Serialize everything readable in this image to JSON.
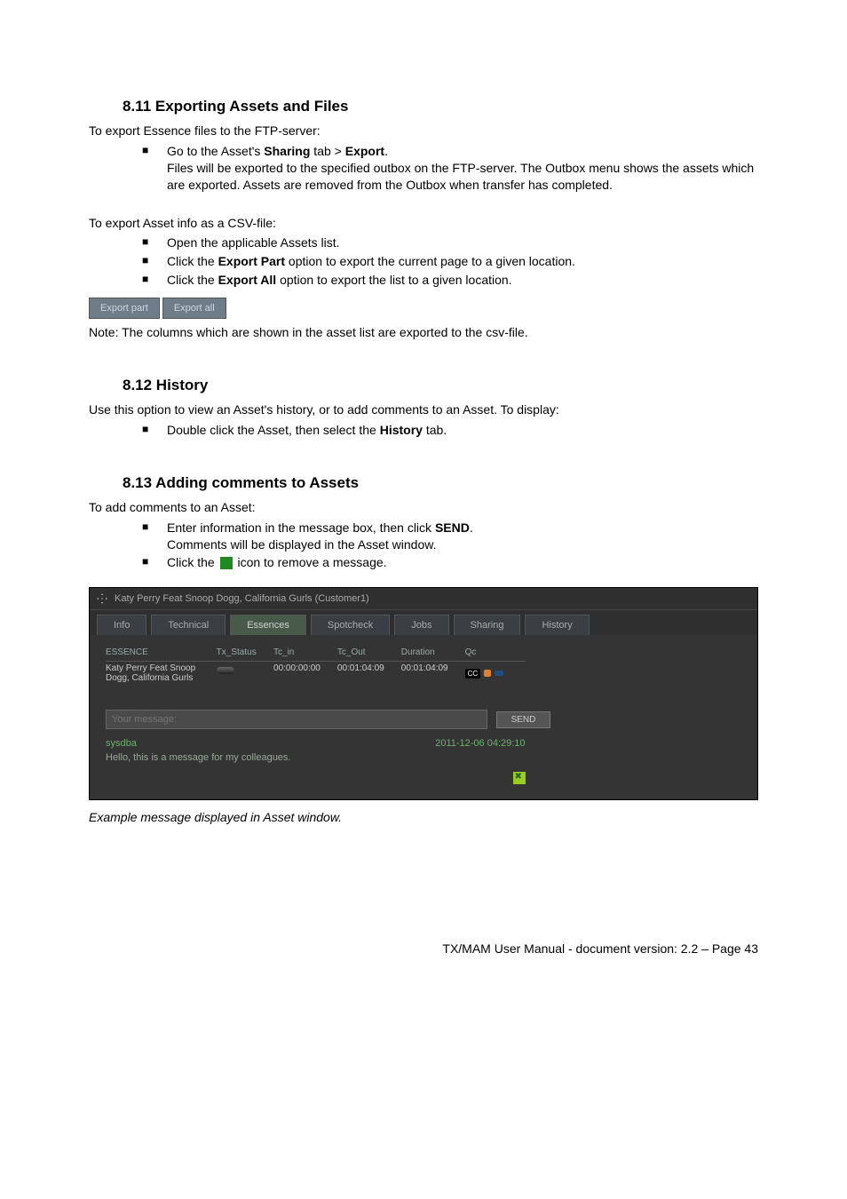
{
  "sections": {
    "s811": {
      "title": "8.11 Exporting Assets and Files"
    },
    "s812": {
      "title": "8.12 History"
    },
    "s813": {
      "title": "8.13 Adding comments to Assets"
    }
  },
  "text": {
    "export_ftp_intro": "To export Essence files to the FTP-server:",
    "export_ftp_b1a": "Go to the Asset's ",
    "export_ftp_b1_bold1": "Sharing",
    "export_ftp_b1b": " tab > ",
    "export_ftp_b1_bold2": "Export",
    "export_ftp_b1c": ".",
    "export_ftp_b1_sub": "Files will be exported to the specified outbox on the FTP-server. The Outbox menu shows the assets which are exported. Assets are removed from the Outbox when transfer has completed.",
    "export_csv_intro": "To export Asset info as a CSV-file:",
    "export_csv_b1": "Open the applicable Assets list.",
    "export_csv_b2a": "Click the ",
    "export_csv_b2_bold": "Export Part",
    "export_csv_b2b": " option to export the current page to a given location.",
    "export_csv_b3a": "Click the ",
    "export_csv_b3_bold": "Export All",
    "export_csv_b3b": " option to export the list to a given location.",
    "export_note": "Note: The columns which are shown in the asset list are exported to the csv-file.",
    "history_intro": "Use this option to view an Asset's history, or to add comments to an Asset. To display:",
    "history_b1a": "Double click the Asset, then select the ",
    "history_b1_bold": "History",
    "history_b1b": " tab.",
    "comments_intro": "To add comments to an Asset:",
    "comments_b1a": "Enter information in the message box, then click ",
    "comments_b1_bold": "SEND",
    "comments_b1b": ".",
    "comments_b1_sub": "Comments will be displayed in the Asset window.",
    "comments_b2a": "Click the ",
    "comments_b2b": " icon to remove a message.",
    "caption": "Example message displayed in Asset window."
  },
  "export_buttons": {
    "part": "Export part",
    "all": "Export all"
  },
  "asset_window": {
    "title": "Katy Perry Feat Snoop Dogg, California Gurls (Customer1)",
    "tabs": {
      "info": "Info",
      "technical": "Technical",
      "essences": "Essences",
      "spotcheck": "Spotcheck",
      "jobs": "Jobs",
      "sharing": "Sharing",
      "history": "History"
    },
    "columns": {
      "essence": "ESSENCE",
      "tx_status": "Tx_Status",
      "tc_in": "Tc_in",
      "tc_out": "Tc_Out",
      "duration": "Duration",
      "qc": "Qc"
    },
    "row": {
      "name": "Katy Perry Feat Snoop Dogg, California Gurls",
      "tc_in": "00:00:00:00",
      "tc_out": "00:01:04:09",
      "duration": "00:01:04:09",
      "qc_cc": "CC"
    },
    "message": {
      "placeholder": "Your message:",
      "send": "SEND",
      "user": "sysdba",
      "date": "2011-12-06 04:29:10",
      "body": "Hello, this is a message for my colleagues."
    }
  },
  "footer": "TX/MAM User Manual - document version: 2.2 – Page 43"
}
